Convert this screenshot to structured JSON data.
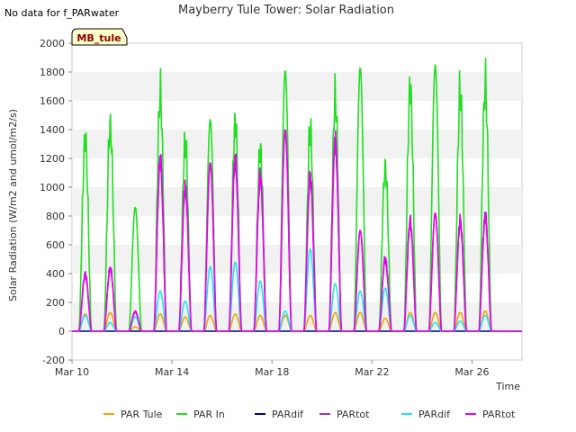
{
  "note": "No data for f_PARwater",
  "chart_data": {
    "type": "line",
    "title": "Mayberry Tule Tower: Solar Radiation",
    "xlabel": "Time",
    "ylabel": "Solar Radiation (W/m2 and umol/m2/s)",
    "badge": "MB_tule",
    "ylim": [
      -200,
      2000
    ],
    "yticks": [
      -200,
      0,
      200,
      400,
      600,
      800,
      1000,
      1200,
      1400,
      1600,
      1800,
      2000
    ],
    "xlim": [
      "2024-03-10",
      "2024-03-28"
    ],
    "xticks": [
      {
        "label": "Mar 10",
        "date": "2024-03-10"
      },
      {
        "label": "Mar 14",
        "date": "2024-03-14"
      },
      {
        "label": "Mar 18",
        "date": "2024-03-18"
      },
      {
        "label": "Mar 22",
        "date": "2024-03-22"
      },
      {
        "label": "Mar 26",
        "date": "2024-03-26"
      }
    ],
    "grid": "horizontal bands",
    "legend_position": "bottom",
    "days": [
      "2024-03-10",
      "2024-03-11",
      "2024-03-12",
      "2024-03-13",
      "2024-03-14",
      "2024-03-15",
      "2024-03-16",
      "2024-03-17",
      "2024-03-18",
      "2024-03-19",
      "2024-03-20",
      "2024-03-21",
      "2024-03-22",
      "2024-03-23",
      "2024-03-24",
      "2024-03-25",
      "2024-03-26",
      "2024-03-27"
    ],
    "series": [
      {
        "name": "PAR Tule",
        "color": "#f5a200",
        "daily_peak": [
          120,
          130,
          30,
          120,
          100,
          110,
          120,
          110,
          110,
          110,
          130,
          130,
          90,
          130,
          130,
          130,
          140,
          0
        ]
      },
      {
        "name": "PAR In",
        "color": "#22dd22",
        "daily_peak": [
          1500,
          1610,
          860,
          1860,
          1470,
          1470,
          1640,
          1420,
          1810,
          1570,
          1830,
          1830,
          1280,
          1900,
          1850,
          1870,
          1920,
          0
        ]
      },
      {
        "name": "PARdif",
        "color": "#00008b",
        "daily_peak": [
          0,
          0,
          0,
          0,
          0,
          0,
          0,
          0,
          0,
          0,
          0,
          0,
          0,
          0,
          0,
          0,
          0,
          0
        ]
      },
      {
        "name": "PARtot",
        "color": "#9933cc",
        "daily_peak": [
          420,
          470,
          130,
          1280,
          1080,
          1170,
          1290,
          1160,
          1400,
          1160,
          1420,
          700,
          540,
          820,
          820,
          820,
          860,
          0
        ]
      },
      {
        "name": "PARdif",
        "color": "#22e5ee",
        "daily_peak": [
          110,
          60,
          100,
          280,
          210,
          450,
          480,
          350,
          140,
          570,
          330,
          280,
          300,
          110,
          60,
          70,
          110,
          0
        ]
      },
      {
        "name": "PARtot",
        "color": "#ee00ee",
        "daily_peak": [
          430,
          470,
          140,
          1280,
          1080,
          1170,
          1290,
          1160,
          1400,
          1160,
          1420,
          700,
          540,
          820,
          820,
          820,
          860,
          0
        ]
      }
    ]
  }
}
